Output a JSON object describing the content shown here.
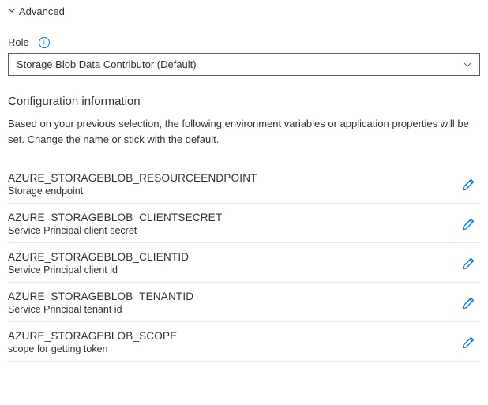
{
  "advanced_label": "Advanced",
  "role": {
    "label": "Role",
    "selected": "Storage Blob Data Contributor (Default)"
  },
  "config": {
    "title": "Configuration information",
    "description": "Based on your previous selection, the following environment variables or application properties will be set. Change the name or stick with the default."
  },
  "variables": [
    {
      "name": "AZURE_STORAGEBLOB_RESOURCEENDPOINT",
      "desc": "Storage endpoint"
    },
    {
      "name": "AZURE_STORAGEBLOB_CLIENTSECRET",
      "desc": "Service Principal client secret"
    },
    {
      "name": "AZURE_STORAGEBLOB_CLIENTID",
      "desc": "Service Principal client id"
    },
    {
      "name": "AZURE_STORAGEBLOB_TENANTID",
      "desc": "Service Principal tenant id"
    },
    {
      "name": "AZURE_STORAGEBLOB_SCOPE",
      "desc": "scope for getting token"
    }
  ]
}
